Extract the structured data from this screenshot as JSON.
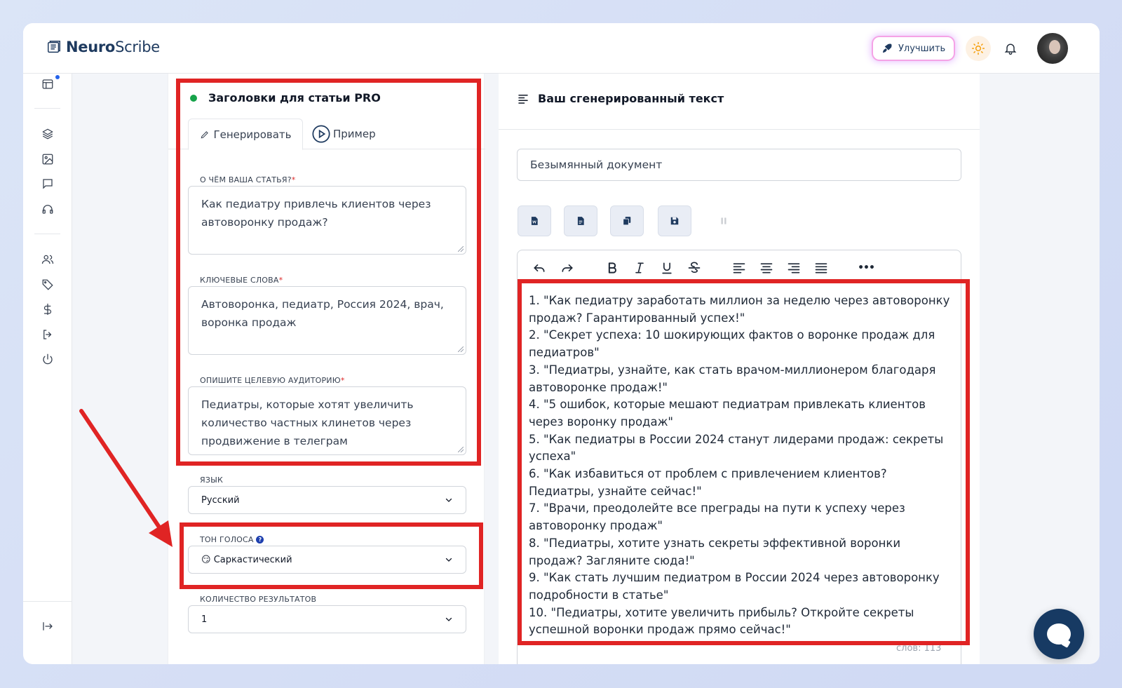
{
  "header": {
    "brand_bold": "Neuro",
    "brand_rest": "Scribe",
    "upgrade_label": "Улучшить"
  },
  "form": {
    "title": "Заголовки для статьи PRO",
    "tab_generate": "Генерировать",
    "tab_example": "Пример",
    "topic_label": "О ЧЁМ ВАША СТАТЬЯ?",
    "topic_value": "Как педиатру привлечь клиентов через автоворонку продаж?",
    "keywords_label": "КЛЮЧЕВЫЕ СЛОВА",
    "keywords_value": "Автоворонка, педиатр, Россия 2024, врач, воронка продаж",
    "audience_label": "ОПИШИТЕ ЦЕЛЕВУЮ АУДИТОРИЮ",
    "audience_value": "Педиатры, которые хотят увеличить количество частных клинетов через продвижение в телеграм",
    "required_mark": "*",
    "language_label": "ЯЗЫК",
    "language_value": "Русский",
    "tone_label": "ТОН ГОЛОСА",
    "tone_help": "?",
    "tone_emoji": "😏",
    "tone_value": "Саркастический",
    "count_label": "КОЛИЧЕСТВО РЕЗУЛЬТАТОВ",
    "count_value": "1"
  },
  "result": {
    "title": "Ваш сгенерированный текст",
    "document_name": "Безымянный документ",
    "more_label": "•••",
    "word_count": "слов: 113",
    "lines": [
      "1. \"Как педиатру заработать миллион за неделю через автоворонку продаж? Гарантированный успех!\"",
      "2. \"Секрет успеха: 10 шокирующих фактов о воронке продаж для педиатров\"",
      "3. \"Педиатры, узнайте, как стать врачом-миллионером благодаря автоворонке продаж!\"",
      "4. \"5 ошибок, которые мешают педиатрам привлекать клиентов через воронку продаж\"",
      "5. \"Как педиатры в России 2024 станут лидерами продаж: секреты успеха\"",
      "6. \"Как избавиться от проблем с привлечением клиентов? Педиатры, узнайте сейчас!\"",
      "7. \"Врачи, преодолейте все преграды на пути к успеху через автоворонку продаж\"",
      "8. \"Педиатры, хотите узнать секреты эффективной воронки продаж? Загляните сюда!\"",
      "9. \"Как стать лучшим педиатром в России 2024 через автоворонку подробности в статье\"",
      "10. \"Педиатры, хотите увеличить прибыль? Откройте секреты успешной воронки продаж прямо сейчас!\""
    ]
  },
  "colors": {
    "accent": "#1e3a5f",
    "annotation_red": "#e02424",
    "status_green": "#16a34a"
  }
}
